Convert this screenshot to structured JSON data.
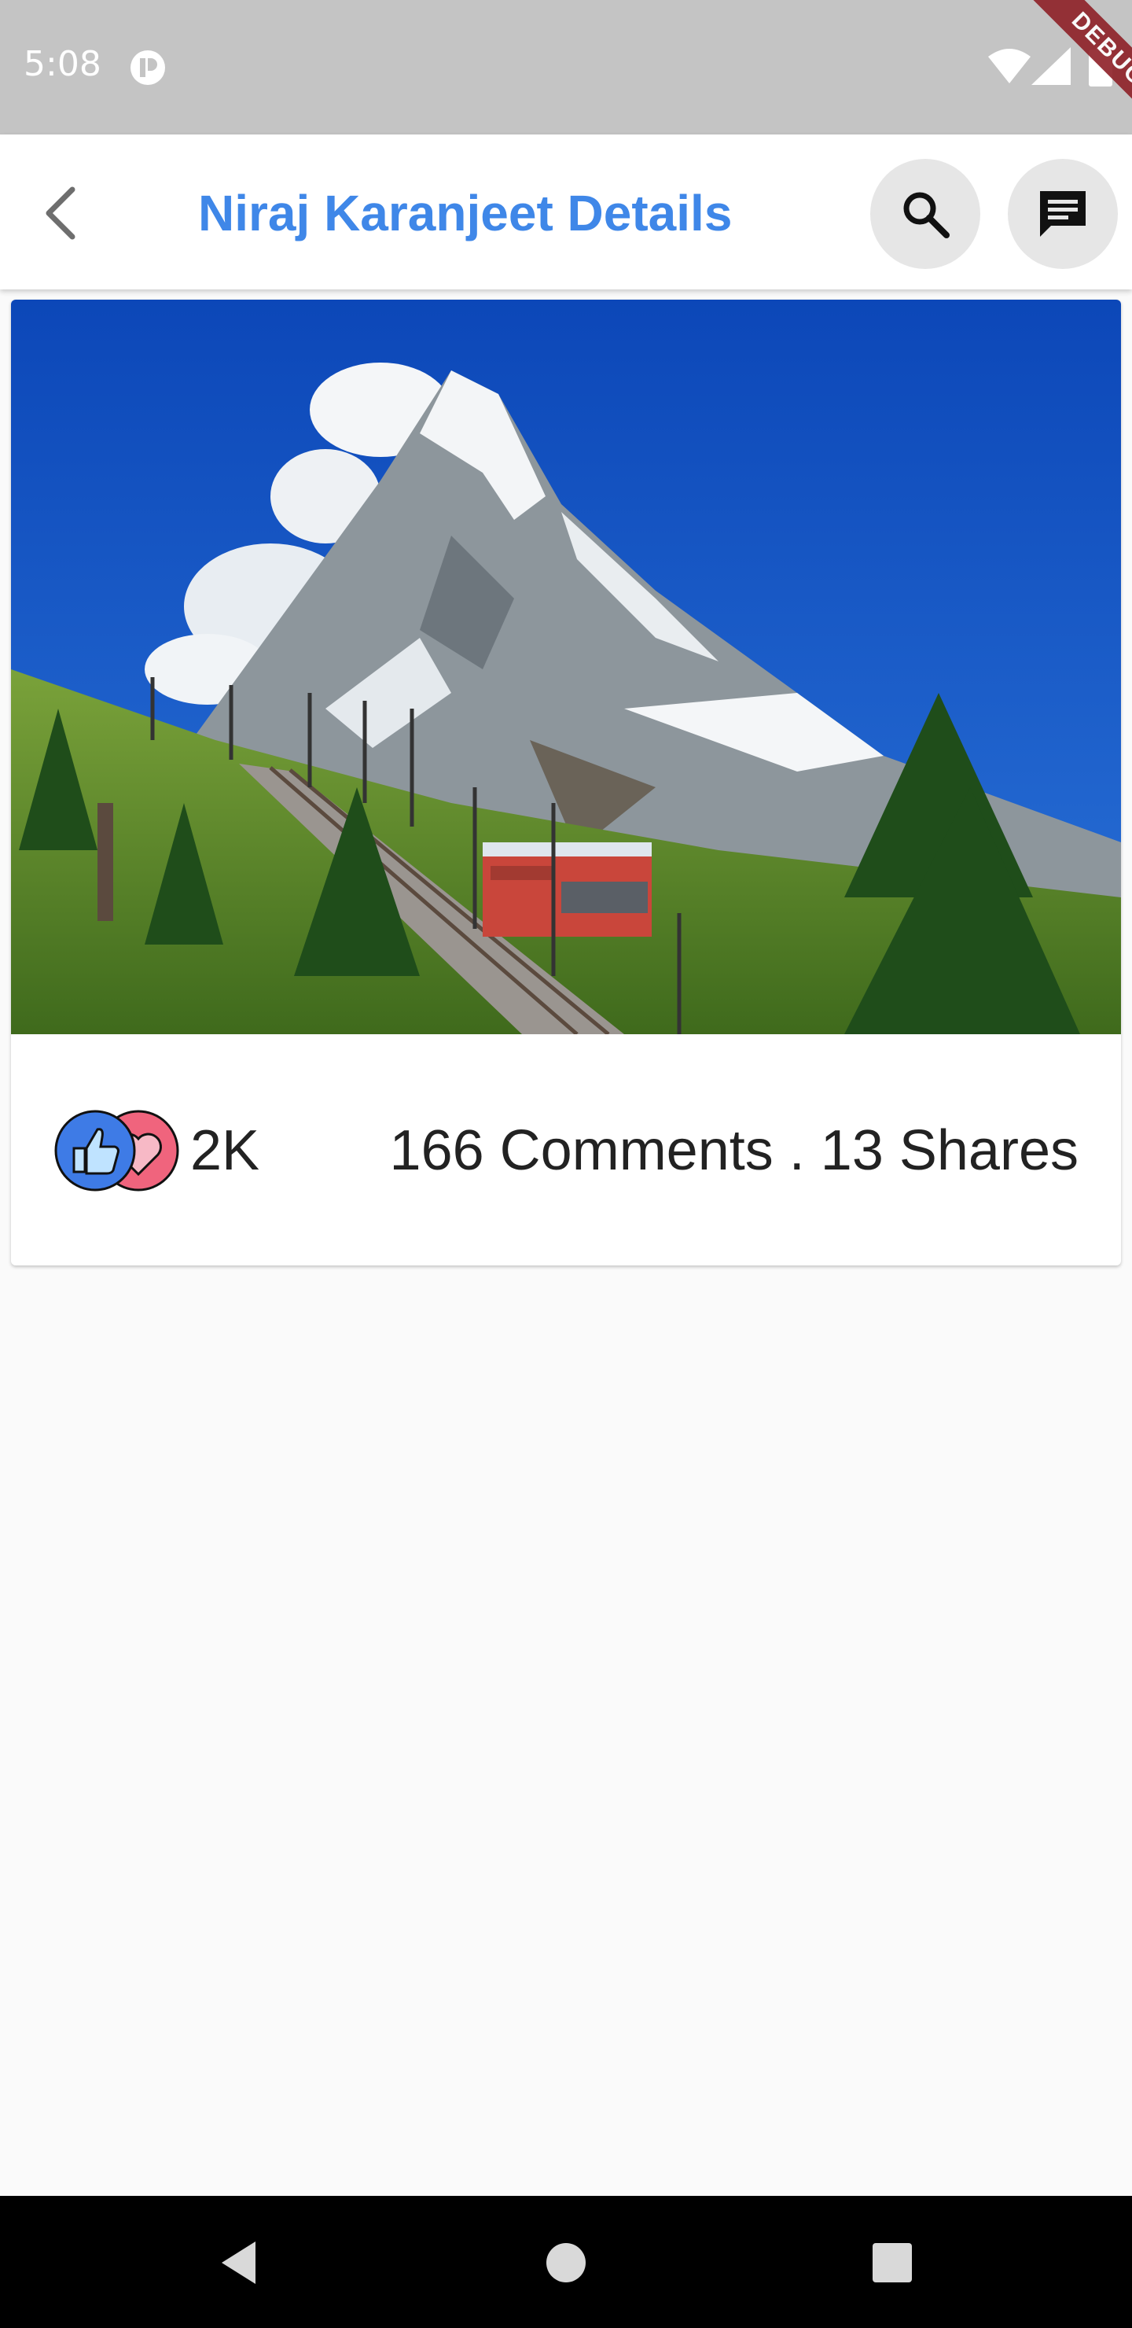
{
  "status_bar": {
    "time": "5:08",
    "debug_label": "DEBUG"
  },
  "app_bar": {
    "title": "Niraj Karanjeet Details",
    "title_color": "#3f87e8",
    "back_icon": "chevron-left-icon",
    "search_icon": "search-icon",
    "messages_icon": "message-icon"
  },
  "post": {
    "image_description_icon": "mountain-train-photo",
    "reactions": [
      "like-icon",
      "heart-icon"
    ],
    "like_count": "2K",
    "comments_shares": "166 Comments . 13 Shares"
  },
  "nav_bar": {
    "back_icon": "nav-back-icon",
    "home_icon": "nav-home-icon",
    "recents_icon": "nav-recents-icon"
  }
}
